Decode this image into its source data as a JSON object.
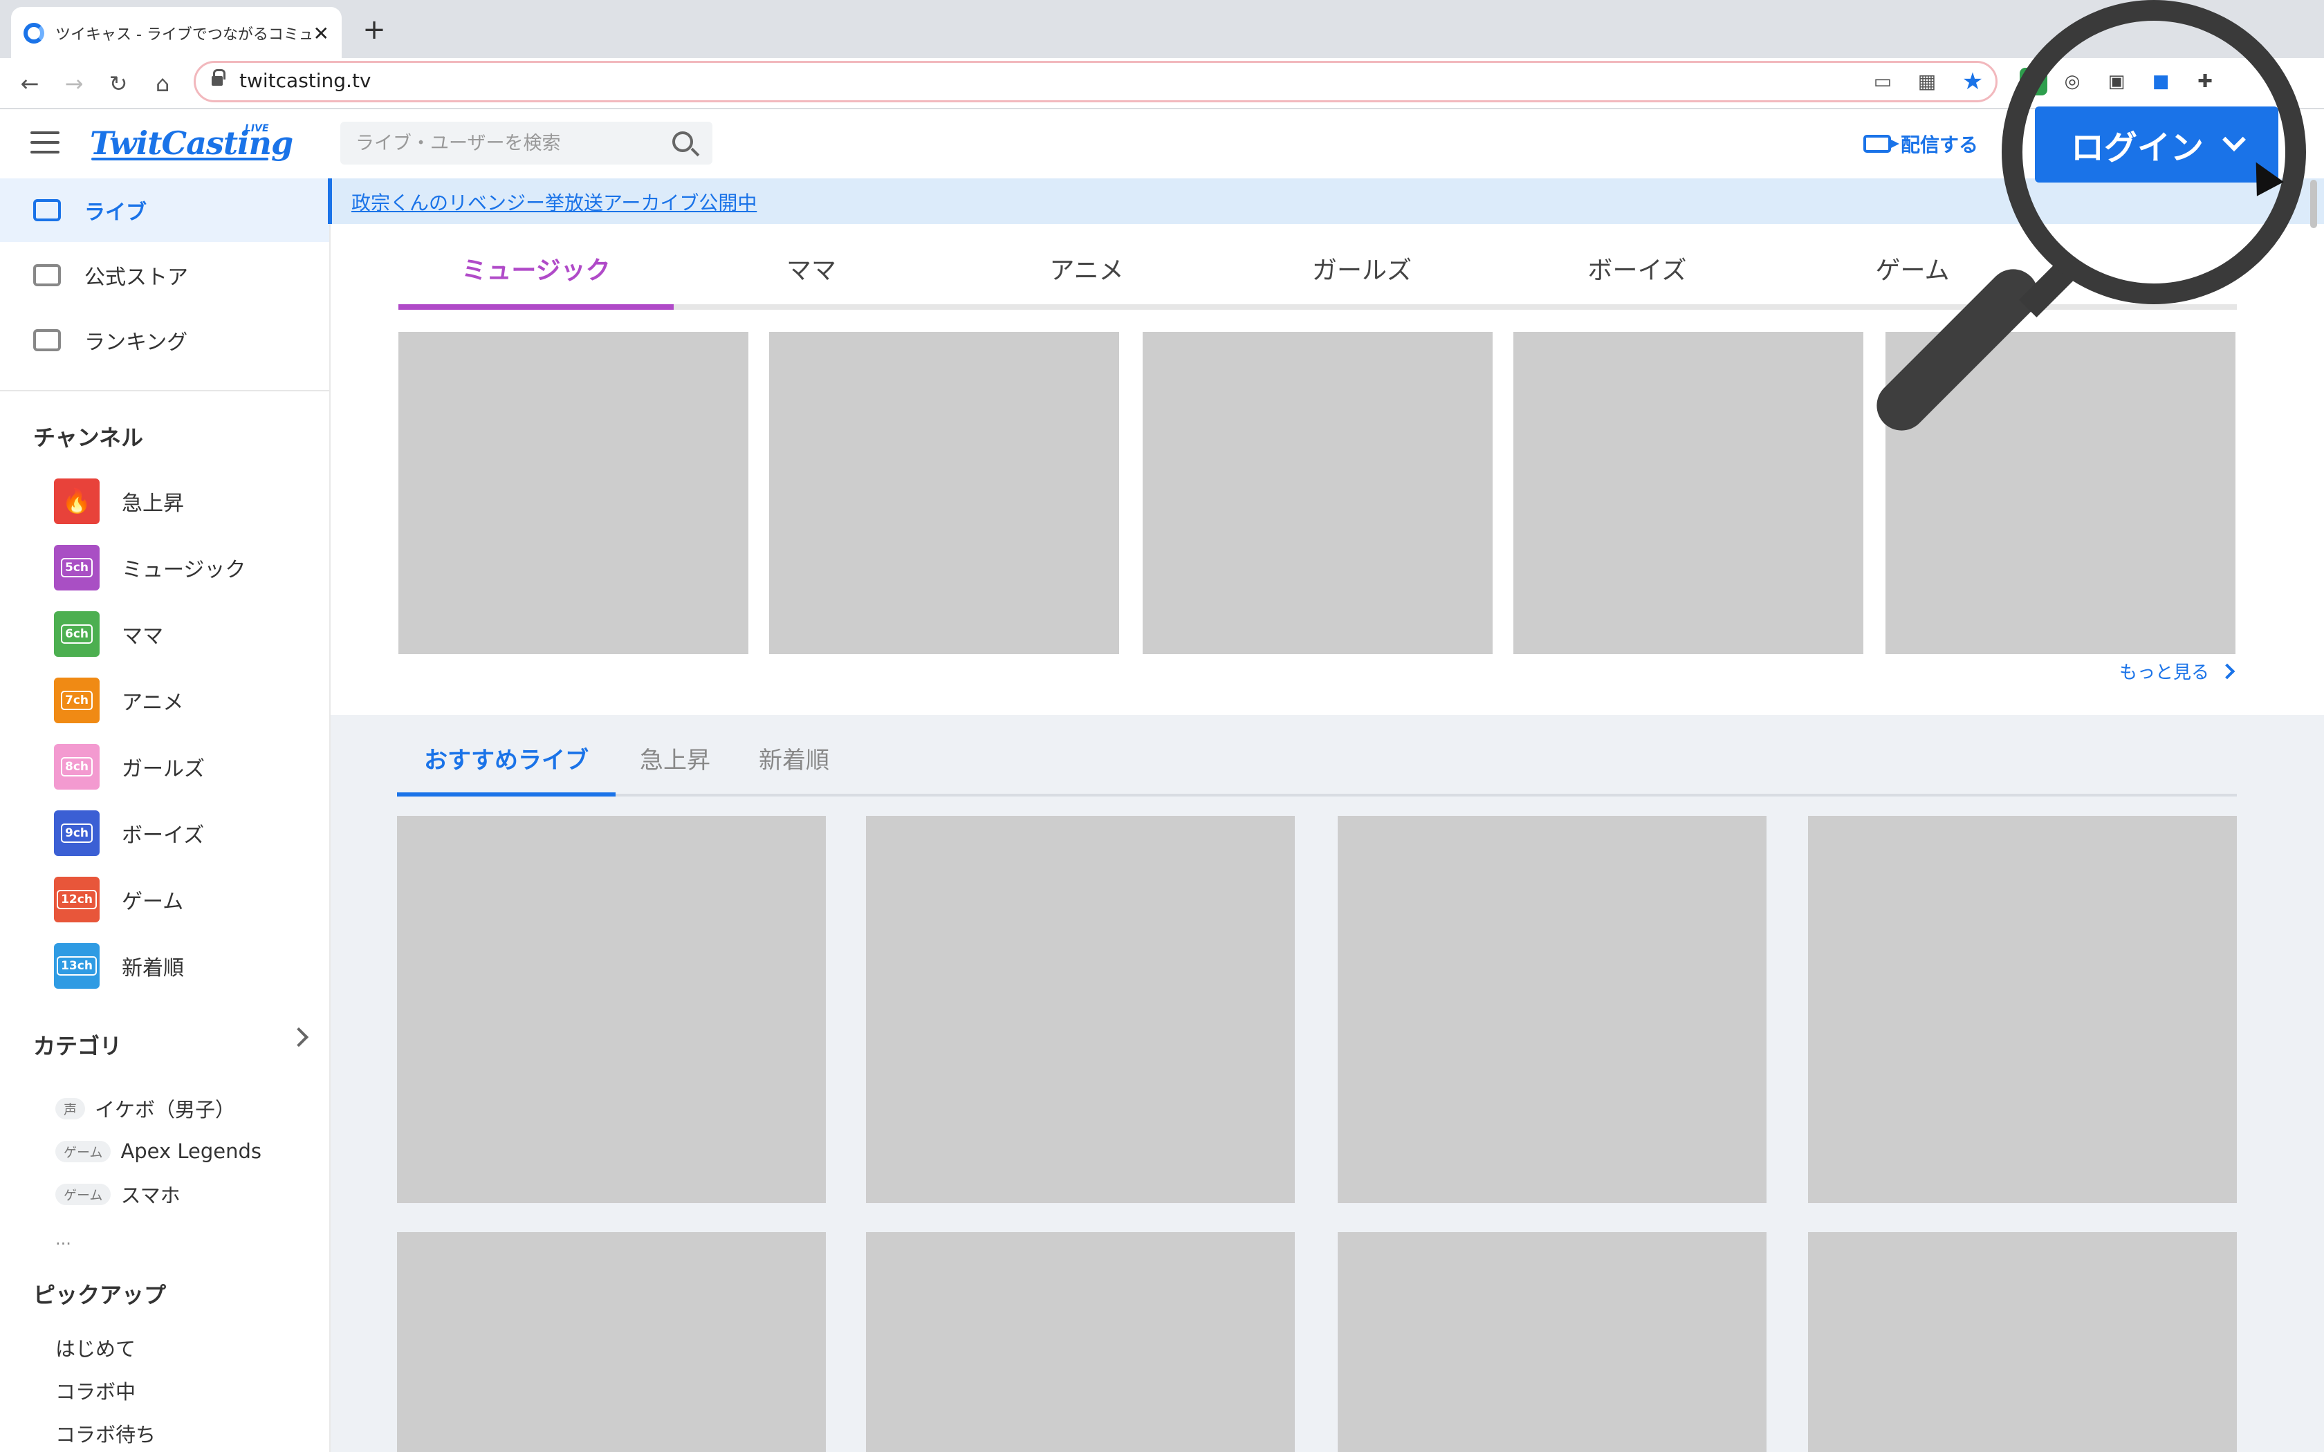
{
  "browser": {
    "tab_title": "ツイキャス - ライブでつながるコミュニティ",
    "tab_close": "✕",
    "new_tab": "+",
    "url": "twitcasting.tv"
  },
  "header": {
    "logo": "TwitCasting",
    "logo_badge": "LIVE",
    "search_placeholder": "ライブ・ユーザーを検索",
    "broadcast_label": "配信する",
    "login_label": "ログイン"
  },
  "sidebar": {
    "nav": [
      {
        "label": "ライブ"
      },
      {
        "label": "公式ストア"
      },
      {
        "label": "ランキング"
      }
    ],
    "channel_heading": "チャンネル",
    "channels": [
      {
        "label": "急上昇",
        "badge": "",
        "color": "#e8423a"
      },
      {
        "label": "ミュージック",
        "badge": "5ch",
        "color": "#a94fc4"
      },
      {
        "label": "ママ",
        "badge": "6ch",
        "color": "#4caf50"
      },
      {
        "label": "アニメ",
        "badge": "7ch",
        "color": "#f08a14"
      },
      {
        "label": "ガールズ",
        "badge": "8ch",
        "color": "#f39ad0"
      },
      {
        "label": "ボーイズ",
        "badge": "9ch",
        "color": "#3b5fd4"
      },
      {
        "label": "ゲーム",
        "badge": "12ch",
        "color": "#e8563a"
      },
      {
        "label": "新着順",
        "badge": "13ch",
        "color": "#2f9be3"
      }
    ],
    "category_heading": "カテゴリ",
    "categories": [
      {
        "tag": "声",
        "label": "イケボ（男子）"
      },
      {
        "tag": "ゲーム",
        "label": "Apex Legends"
      },
      {
        "tag": "ゲーム",
        "label": "スマホ"
      }
    ],
    "category_more": "...",
    "pickup_heading": "ピックアップ",
    "pickups": [
      "はじめて",
      "コラボ中",
      "コラボ待ち"
    ]
  },
  "main": {
    "banner": "政宗くんのリベンジー挙放送アーカイブ公開中",
    "genre_tabs": [
      "ミュージック",
      "ママ",
      "アニメ",
      "ガールズ",
      "ボーイズ",
      "ゲーム"
    ],
    "more_link": "もっと見る",
    "live_tabs": [
      "おすすめライブ",
      "急上昇",
      "新着順"
    ]
  },
  "colors": {
    "brand": "#1a73e8",
    "music_accent": "#b04ac8"
  }
}
